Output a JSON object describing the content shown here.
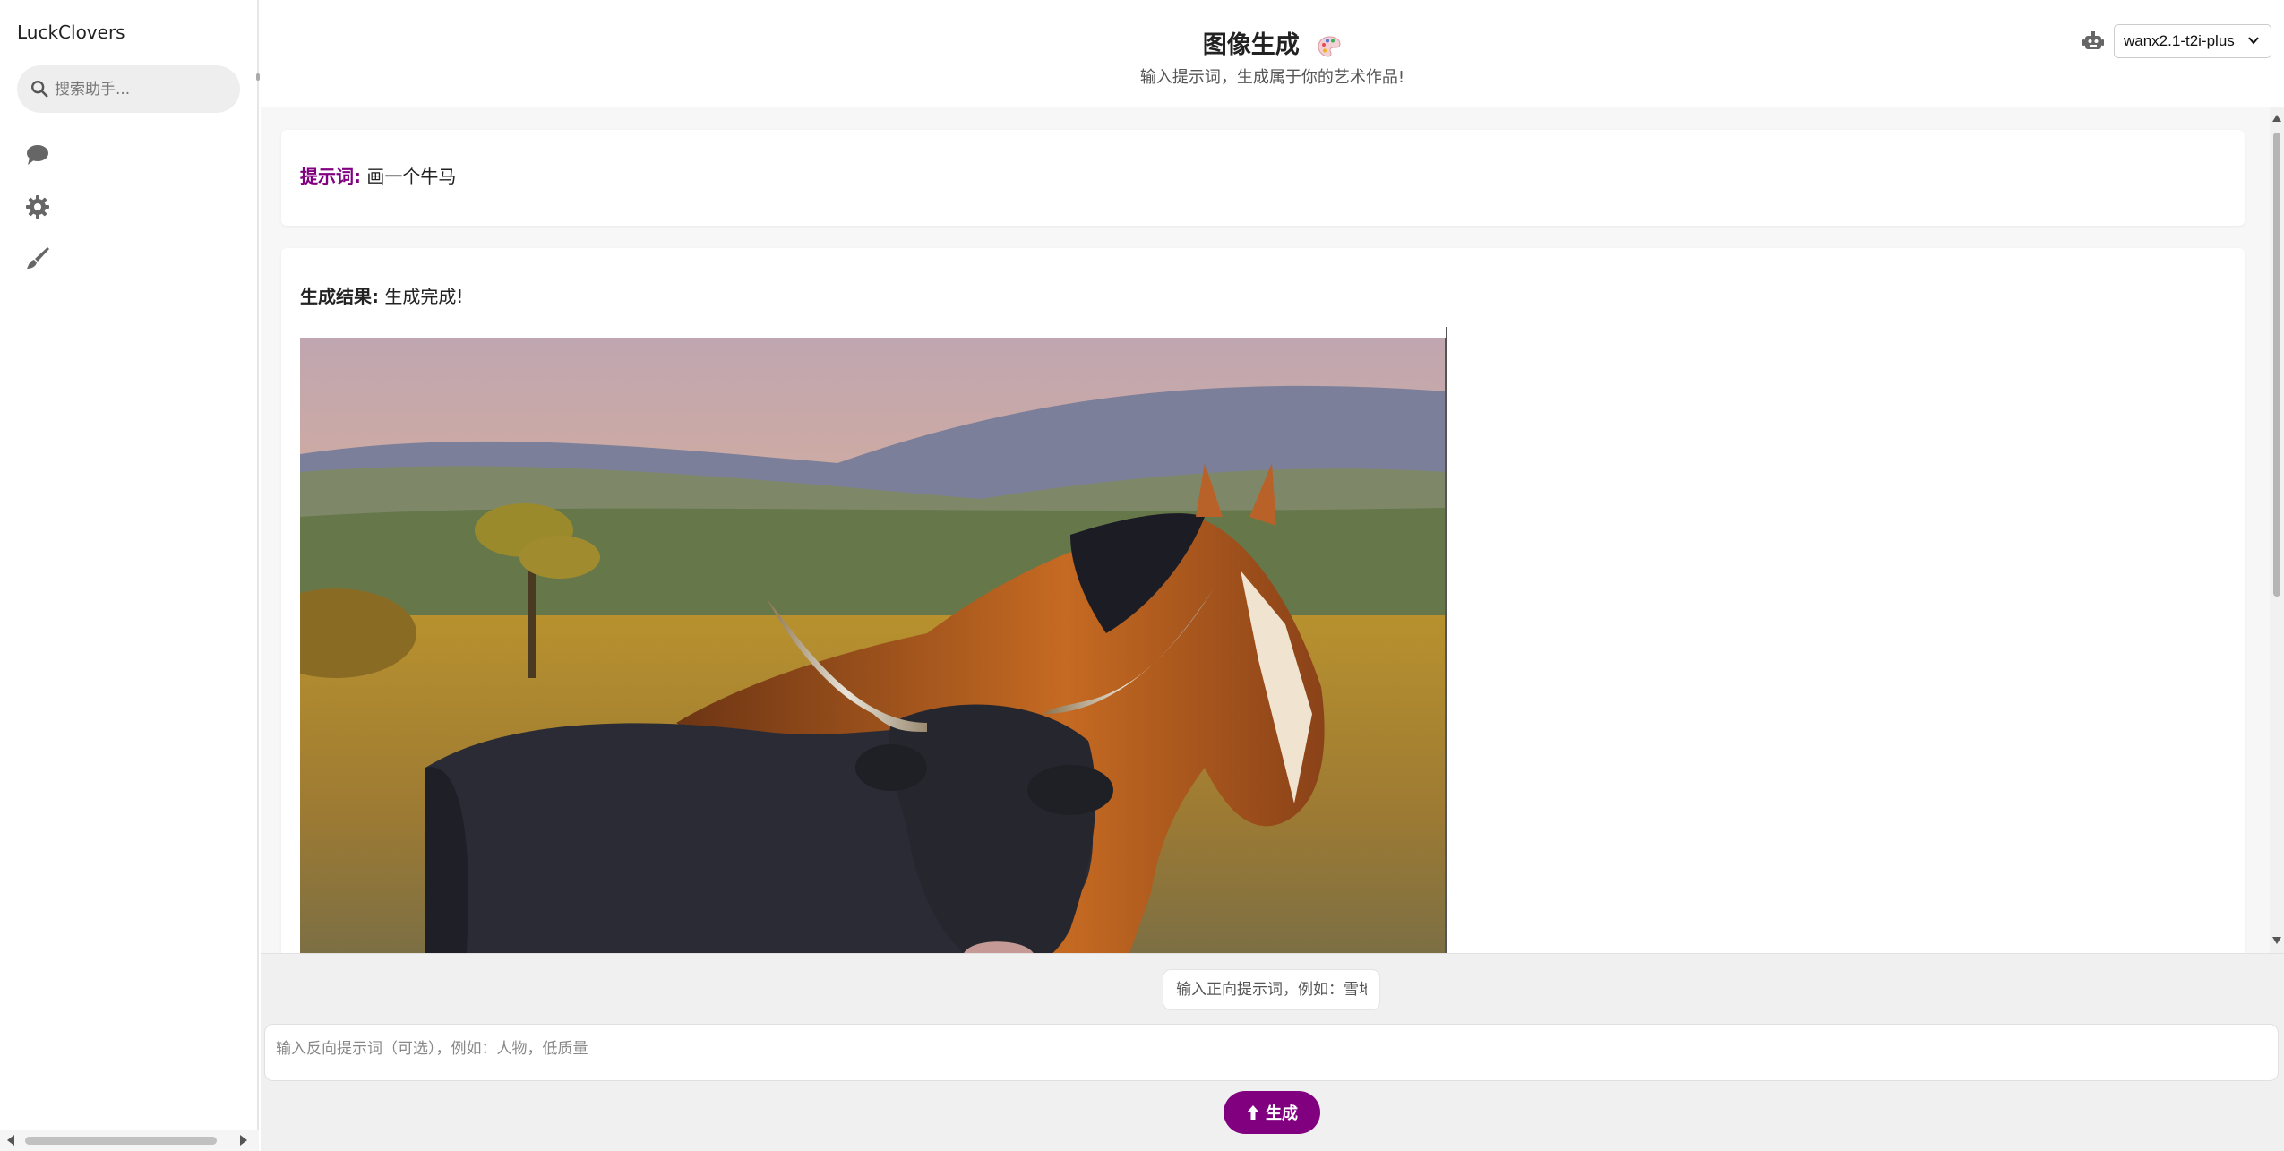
{
  "sidebar": {
    "brand": "LuckClovers",
    "search_placeholder": "搜索助手...",
    "icons": [
      "chat-icon",
      "gear-icon",
      "brush-icon"
    ]
  },
  "header": {
    "title": "图像生成",
    "subtitle": "输入提示词，生成属于你的艺术作品!",
    "model_selected": "wanx2.1-t2i-plus"
  },
  "prompt": {
    "label": "提示词:",
    "text": "画一个牛马"
  },
  "result": {
    "label": "生成结果:",
    "status": "生成完成!"
  },
  "inputs": {
    "positive_placeholder": "输入正向提示词，例如：雪地",
    "negative_placeholder": "输入反向提示词（可选），例如：人物，低质量",
    "generate_label": "生成"
  },
  "colors": {
    "accent": "#800080",
    "bg": "#f7f7f7"
  }
}
